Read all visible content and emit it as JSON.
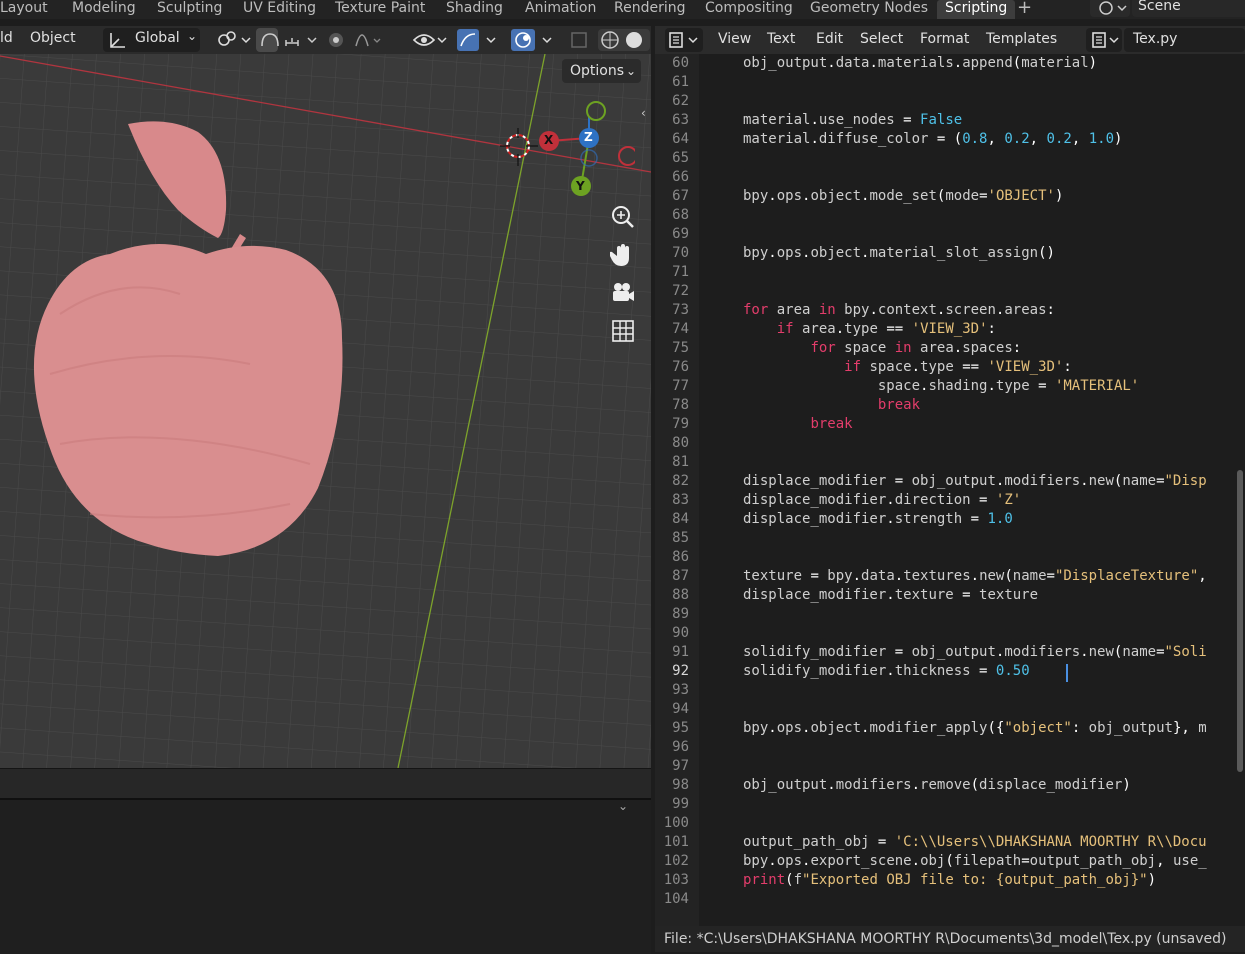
{
  "workspace_tabs": [
    "Layout",
    "Modeling",
    "Sculpting",
    "UV Editing",
    "Texture Paint",
    "Shading",
    "Animation",
    "Rendering",
    "Compositing",
    "Geometry Nodes",
    "Scripting"
  ],
  "active_tab": "Scripting",
  "scene": {
    "name": "Scene"
  },
  "viewport": {
    "menu_partial": "ld",
    "object_menu": "Object",
    "orientation": "Global",
    "options_label": "Options",
    "gizmo": {
      "x": "X",
      "y": "Y",
      "z": "Z"
    },
    "icons": [
      "zoom-icon",
      "hand-pan-icon",
      "camera-icon",
      "grid-icon"
    ],
    "apple_color": "#e59a9a"
  },
  "text_editor": {
    "menus": [
      "View",
      "Text",
      "Edit",
      "Select",
      "Format",
      "Templates"
    ],
    "filename": "Tex.py",
    "current_line": 92,
    "line_numbers": [
      60,
      61,
      62,
      63,
      64,
      65,
      66,
      67,
      68,
      69,
      70,
      71,
      72,
      73,
      74,
      75,
      76,
      77,
      78,
      79,
      80,
      81,
      82,
      83,
      84,
      85,
      86,
      87,
      88,
      89,
      90,
      91,
      92,
      93,
      94,
      95,
      96,
      97,
      98,
      99,
      100,
      101,
      102,
      103,
      104
    ],
    "lines": [
      "obj_output.data.materials.append(material)",
      "",
      "",
      "material.use_nodes = False",
      "material.diffuse_color = (0.8, 0.2, 0.2, 1.0)",
      "",
      "",
      "bpy.ops.object.mode_set(mode='OBJECT')",
      "",
      "",
      "bpy.ops.object.material_slot_assign()",
      "",
      "",
      "for area in bpy.context.screen.areas:",
      "    if area.type == 'VIEW_3D':",
      "        for space in area.spaces:",
      "            if space.type == 'VIEW_3D':",
      "                space.shading.type = 'MATERIAL'",
      "                break",
      "        break",
      "",
      "",
      "displace_modifier = obj_output.modifiers.new(name=\"Disp",
      "displace_modifier.direction = 'Z'",
      "displace_modifier.strength = 1.0",
      "",
      "",
      "texture = bpy.data.textures.new(name=\"DisplaceTexture\",",
      "displace_modifier.texture = texture",
      "",
      "",
      "solidify_modifier = obj_output.modifiers.new(name=\"Soli",
      "solidify_modifier.thickness = 0.50",
      "",
      "",
      "bpy.ops.object.modifier_apply({\"object\": obj_output}, m",
      "",
      "",
      "obj_output.modifiers.remove(displace_modifier)",
      "",
      "",
      "output_path_obj = 'C:\\\\Users\\\\DHAKSHANA MOORTHY R\\\\Docu",
      "bpy.ops.export_scene.obj(filepath=output_path_obj, use_",
      "print(f\"Exported OBJ file to: {output_path_obj}\")",
      ""
    ]
  },
  "status": "File: *C:\\Users\\DHAKSHANA MOORTHY R\\Documents\\3d_model\\Tex.py (unsaved)"
}
